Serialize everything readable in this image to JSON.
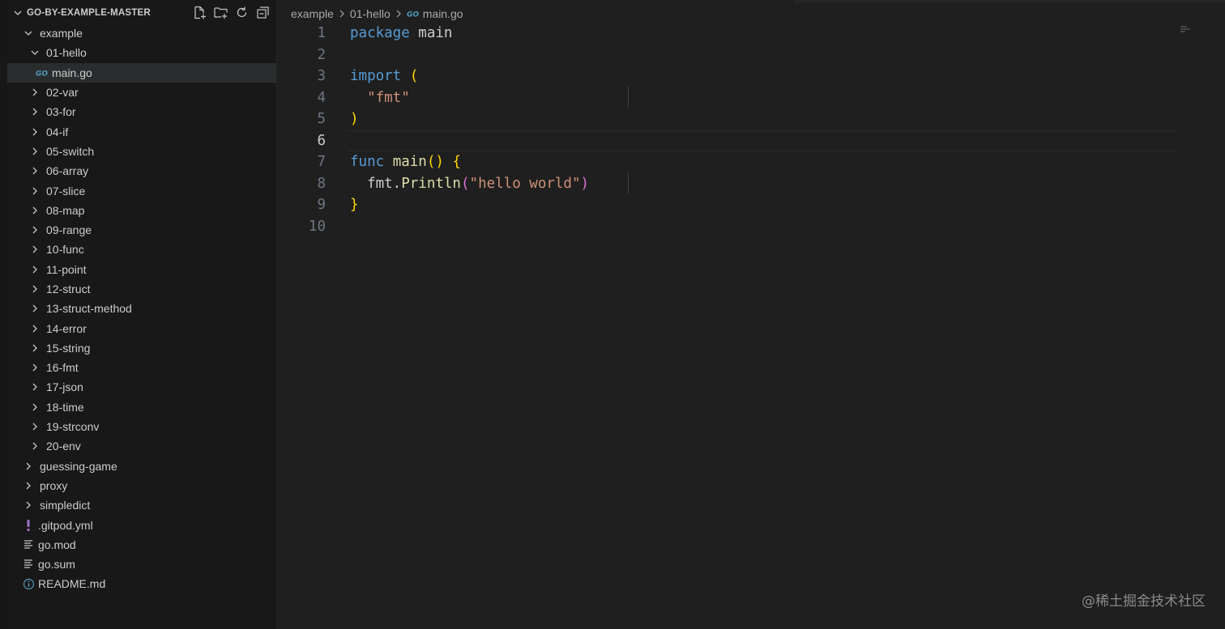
{
  "explorer": {
    "title": "GO-BY-EXAMPLE-MASTER",
    "actions": [
      "new-file-icon",
      "new-folder-icon",
      "refresh-icon",
      "collapse-all-icon"
    ],
    "items": [
      {
        "label": "example",
        "type": "folder",
        "expanded": true,
        "depth": 0
      },
      {
        "label": "01-hello",
        "type": "folder",
        "expanded": true,
        "depth": 1
      },
      {
        "label": "main.go",
        "type": "go-file",
        "depth": 2,
        "selected": true
      },
      {
        "label": "02-var",
        "type": "folder",
        "expanded": false,
        "depth": 1
      },
      {
        "label": "03-for",
        "type": "folder",
        "expanded": false,
        "depth": 1
      },
      {
        "label": "04-if",
        "type": "folder",
        "expanded": false,
        "depth": 1
      },
      {
        "label": "05-switch",
        "type": "folder",
        "expanded": false,
        "depth": 1
      },
      {
        "label": "06-array",
        "type": "folder",
        "expanded": false,
        "depth": 1
      },
      {
        "label": "07-slice",
        "type": "folder",
        "expanded": false,
        "depth": 1
      },
      {
        "label": "08-map",
        "type": "folder",
        "expanded": false,
        "depth": 1
      },
      {
        "label": "09-range",
        "type": "folder",
        "expanded": false,
        "depth": 1
      },
      {
        "label": "10-func",
        "type": "folder",
        "expanded": false,
        "depth": 1
      },
      {
        "label": "11-point",
        "type": "folder",
        "expanded": false,
        "depth": 1
      },
      {
        "label": "12-struct",
        "type": "folder",
        "expanded": false,
        "depth": 1
      },
      {
        "label": "13-struct-method",
        "type": "folder",
        "expanded": false,
        "depth": 1
      },
      {
        "label": "14-error",
        "type": "folder",
        "expanded": false,
        "depth": 1
      },
      {
        "label": "15-string",
        "type": "folder",
        "expanded": false,
        "depth": 1
      },
      {
        "label": "16-fmt",
        "type": "folder",
        "expanded": false,
        "depth": 1
      },
      {
        "label": "17-json",
        "type": "folder",
        "expanded": false,
        "depth": 1
      },
      {
        "label": "18-time",
        "type": "folder",
        "expanded": false,
        "depth": 1
      },
      {
        "label": "19-strconv",
        "type": "folder",
        "expanded": false,
        "depth": 1
      },
      {
        "label": "20-env",
        "type": "folder",
        "expanded": false,
        "depth": 1
      },
      {
        "label": "guessing-game",
        "type": "folder",
        "expanded": false,
        "depth": 0
      },
      {
        "label": "proxy",
        "type": "folder",
        "expanded": false,
        "depth": 0
      },
      {
        "label": "simpledict",
        "type": "folder",
        "expanded": false,
        "depth": 0
      },
      {
        "label": ".gitpod.yml",
        "type": "yml-file",
        "depth": 0
      },
      {
        "label": "go.mod",
        "type": "text-file",
        "depth": 0
      },
      {
        "label": "go.sum",
        "type": "text-file",
        "depth": 0
      },
      {
        "label": "README.md",
        "type": "info-file",
        "depth": 0
      }
    ]
  },
  "breadcrumb": [
    "example",
    "01-hello",
    "main.go"
  ],
  "editor": {
    "current_line": 6,
    "lines": [
      {
        "n": "1",
        "tokens": [
          {
            "t": "package",
            "c": "kw"
          },
          {
            "t": " main",
            "c": ""
          }
        ]
      },
      {
        "n": "2",
        "tokens": []
      },
      {
        "n": "3",
        "tokens": [
          {
            "t": "import",
            "c": "kw"
          },
          {
            "t": " ",
            "c": ""
          },
          {
            "t": "(",
            "c": "p1"
          }
        ]
      },
      {
        "n": "4",
        "indent": true,
        "tokens": [
          {
            "t": "  ",
            "c": ""
          },
          {
            "t": "\"fmt\"",
            "c": "str"
          }
        ]
      },
      {
        "n": "5",
        "tokens": [
          {
            "t": ")",
            "c": "p1"
          }
        ]
      },
      {
        "n": "6",
        "tokens": []
      },
      {
        "n": "7",
        "tokens": [
          {
            "t": "func",
            "c": "kw"
          },
          {
            "t": " ",
            "c": ""
          },
          {
            "t": "main",
            "c": "fn"
          },
          {
            "t": "()",
            "c": "p1"
          },
          {
            "t": " ",
            "c": ""
          },
          {
            "t": "{",
            "c": "p1"
          }
        ]
      },
      {
        "n": "8",
        "indent": true,
        "tokens": [
          {
            "t": "  fmt.",
            "c": ""
          },
          {
            "t": "Println",
            "c": "fn"
          },
          {
            "t": "(",
            "c": "p2"
          },
          {
            "t": "\"hello world\"",
            "c": "str"
          },
          {
            "t": ")",
            "c": "p2"
          }
        ]
      },
      {
        "n": "9",
        "tokens": [
          {
            "t": "}",
            "c": "p1"
          }
        ]
      },
      {
        "n": "10",
        "tokens": []
      }
    ]
  },
  "watermark": "@稀土掘金技术社区",
  "colors": {
    "keyword": "#569cd6",
    "function": "#dcdcaa",
    "string": "#ce9178",
    "bracket1": "#ffd700",
    "bracket2": "#da70d6",
    "go_icon": "#519aba"
  }
}
